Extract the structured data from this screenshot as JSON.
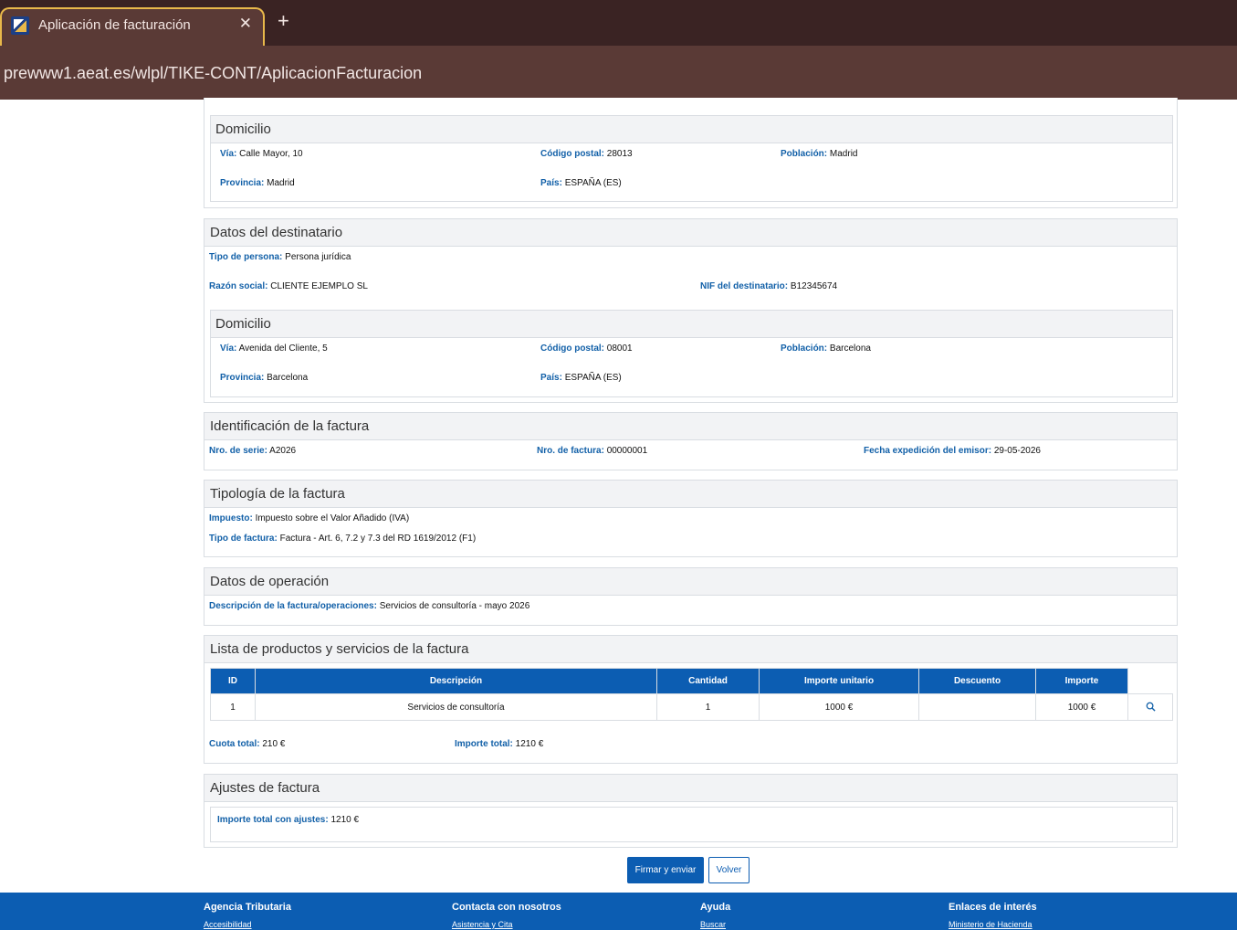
{
  "browser": {
    "tab_title": "Aplicación de facturación",
    "tab_close": "✕",
    "new_tab": "+",
    "url": "prewww1.aeat.es/wlpl/TIKE-CONT/AplicacionFacturacion"
  },
  "emisor_domicilio": {
    "title": "Domicilio",
    "via_label": "Vía:",
    "via": "Calle Mayor, 10",
    "cp_label": "Código postal:",
    "cp": "28013",
    "poblacion_label": "Población:",
    "poblacion": "Madrid",
    "provincia_label": "Provincia:",
    "provincia": "Madrid",
    "pais_label": "País:",
    "pais": "ESPAÑA (ES)"
  },
  "destinatario": {
    "title": "Datos del destinatario",
    "tipo_label": "Tipo de persona:",
    "tipo": "Persona jurídica",
    "razon_label": "Razón social:",
    "razon": "CLIENTE EJEMPLO SL",
    "nif_label": "NIF del destinatario:",
    "nif": "B12345674",
    "domicilio": {
      "title": "Domicilio",
      "via_label": "Vía:",
      "via": "Avenida del Cliente, 5",
      "cp_label": "Código postal:",
      "cp": "08001",
      "poblacion_label": "Población:",
      "poblacion": "Barcelona",
      "provincia_label": "Provincia:",
      "provincia": "Barcelona",
      "pais_label": "País:",
      "pais": "ESPAÑA (ES)"
    }
  },
  "identificacion": {
    "title": "Identificación de la factura",
    "serie_label": "Nro. de serie:",
    "serie": "A2026",
    "factura_label": "Nro. de factura:",
    "factura": "00000001",
    "fecha_label": "Fecha expedición del emisor:",
    "fecha": "29-05-2026"
  },
  "tipologia": {
    "title": "Tipología de la factura",
    "impuesto_label": "Impuesto:",
    "impuesto": "Impuesto sobre el Valor Añadido (IVA)",
    "tipo_label": "Tipo de factura:",
    "tipo": "Factura - Art. 6, 7.2 y 7.3 del RD 1619/2012 (F1)"
  },
  "operacion": {
    "title": "Datos de operación",
    "desc_label": "Descripción de la factura/operaciones:",
    "desc": "Servicios de consultoría - mayo 2026"
  },
  "productos": {
    "title": "Lista de productos y servicios de la factura",
    "columns": [
      "ID",
      "Descripción",
      "Cantidad",
      "Importe unitario",
      "Descuento",
      "Importe"
    ],
    "rows": [
      {
        "id": "1",
        "descripcion": "Servicios de consultoría",
        "cantidad": "1",
        "unitario": "1000 €",
        "descuento": "",
        "importe": "1000 €"
      }
    ],
    "cuota_label": "Cuota total:",
    "cuota": "210 €",
    "total_label": "Importe total:",
    "total": "1210 €"
  },
  "ajustes": {
    "title": "Ajustes de factura",
    "total_label": "Importe total con ajustes:",
    "total": "1210 €"
  },
  "actions": {
    "firmar": "Firmar y enviar",
    "volver": "Volver"
  },
  "footer": {
    "col1": {
      "title": "Agencia Tributaria",
      "link": "Accesibilidad"
    },
    "col2": {
      "title": "Contacta con nosotros",
      "link": "Asistencia y Cita"
    },
    "col3": {
      "title": "Ayuda",
      "link": "Buscar"
    },
    "col4": {
      "title": "Enlaces de interés",
      "link": "Ministerio de Hacienda"
    }
  },
  "colors": {
    "accent": "#0c5db2",
    "label": "#1260a8",
    "chrome": "#3a2323"
  }
}
